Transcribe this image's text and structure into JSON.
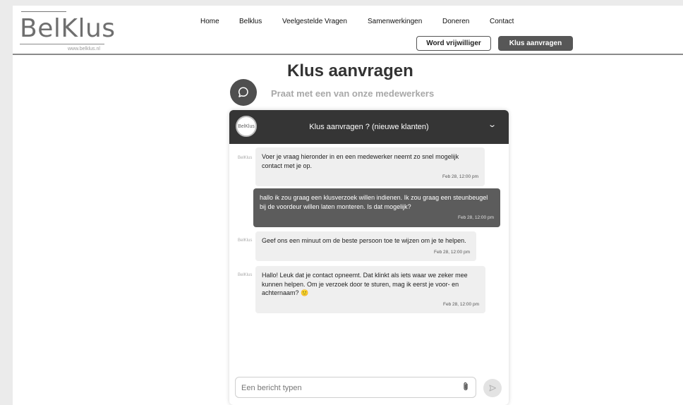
{
  "logo": {
    "text": "BelKlus",
    "url": "www.belklus.nl"
  },
  "nav": [
    {
      "label": "Home"
    },
    {
      "label": "Belklus"
    },
    {
      "label": "Veelgestelde Vragen"
    },
    {
      "label": "Samenwerkingen"
    },
    {
      "label": "Doneren"
    },
    {
      "label": "Contact"
    }
  ],
  "buttons": {
    "volunteer": "Word vrijwilliger",
    "request": "Klus aanvragen"
  },
  "page": {
    "title": "Klus aanvragen",
    "subtitle": "Praat met een van onze medewerkers"
  },
  "chat": {
    "header_avatar": "BelKlus",
    "header_title": "Klus aanvragen ? (nieuwe klanten)",
    "messages": [
      {
        "from": "agent",
        "icon": "BelKlus",
        "text": "Voer je vraag hieronder in en een medewerker neemt zo snel mogelijk contact met je op.",
        "time": "Feb 28, 12:00 pm"
      },
      {
        "from": "user",
        "text": "hallo ik zou graag een klusverzoek willen indienen. Ik zou graag een steunbeugel bij de voordeur willen laten monteren. Is dat mogelijk?",
        "time": "Feb 28, 12:00 pm"
      },
      {
        "from": "agent",
        "icon": "BelKlus",
        "text": "Geef ons een minuut om de beste persoon toe te wijzen om je te helpen.",
        "time": "Feb 28, 12:00 pm"
      },
      {
        "from": "agent",
        "icon": "BelKlus",
        "text": "Hallo! Leuk dat je contact opneemt. Dat klinkt als iets waar we zeker mee kunnen helpen. Om je verzoek door te sturen, mag ik eerst je voor- en achternaam? 🙂",
        "time": "Feb 28, 12:00 pm"
      }
    ],
    "input_placeholder": "Een bericht typen"
  }
}
